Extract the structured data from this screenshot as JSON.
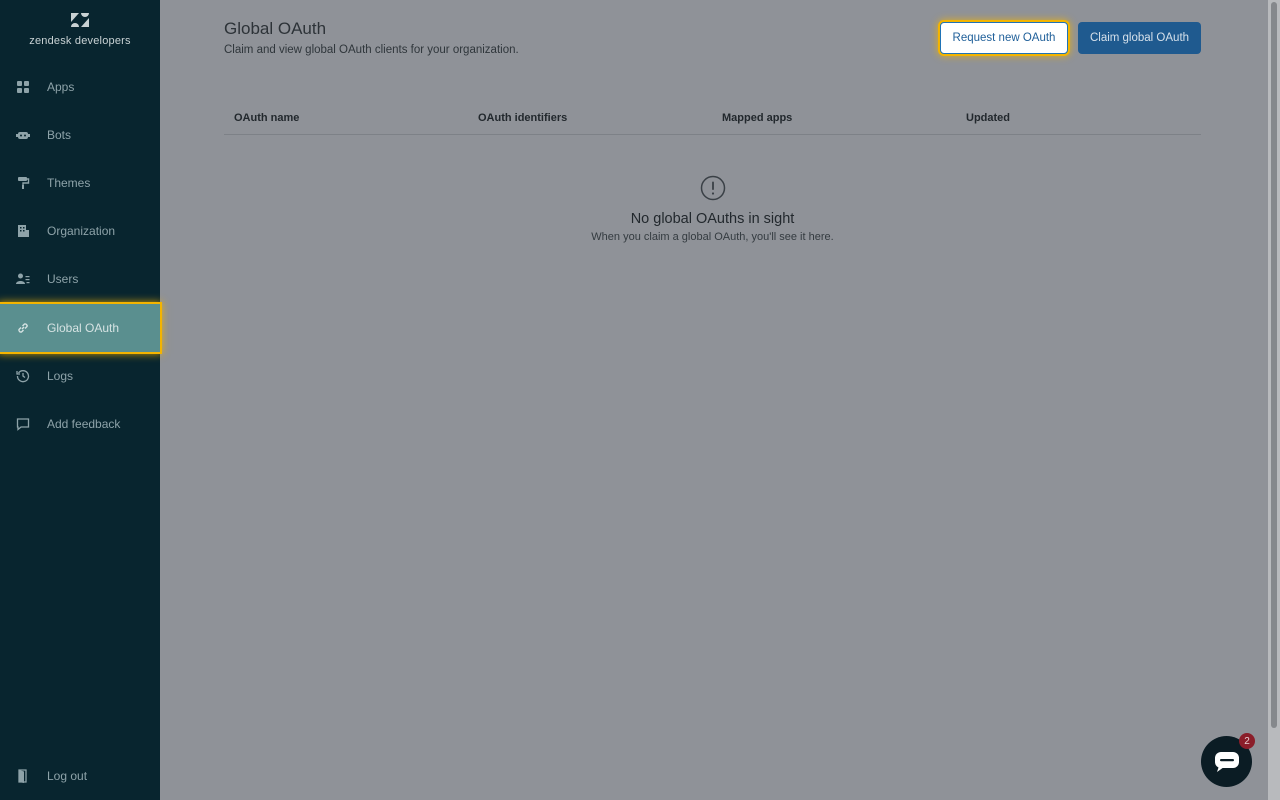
{
  "brand": {
    "name": "zendesk developers"
  },
  "sidebar": {
    "items": [
      {
        "label": "Apps",
        "icon": "apps-grid-icon"
      },
      {
        "label": "Bots",
        "icon": "bot-icon"
      },
      {
        "label": "Themes",
        "icon": "paint-roller-icon"
      },
      {
        "label": "Organization",
        "icon": "building-icon"
      },
      {
        "label": "Users",
        "icon": "users-icon"
      },
      {
        "label": "Global OAuth",
        "icon": "link-icon",
        "active": true
      },
      {
        "label": "Logs",
        "icon": "history-icon"
      },
      {
        "label": "Add feedback",
        "icon": "speech-bubble-icon"
      }
    ],
    "logout": {
      "label": "Log out",
      "icon": "door-icon"
    }
  },
  "page": {
    "title": "Global OAuth",
    "subtitle": "Claim and view global OAuth clients for your organization."
  },
  "actions": {
    "request_label": "Request new OAuth",
    "claim_label": "Claim global OAuth"
  },
  "table": {
    "columns": [
      "OAuth name",
      "OAuth identifiers",
      "Mapped apps",
      "Updated"
    ]
  },
  "empty_state": {
    "title": "No global OAuths in sight",
    "description": "When you claim a global OAuth, you'll see it here."
  },
  "chat": {
    "badge_count": "2"
  },
  "colors": {
    "sidebar_bg": "#08252f",
    "active_item_bg": "#5a8f8f",
    "primary_button": "#1f5a8f",
    "focus_ring": "#f4b400"
  }
}
